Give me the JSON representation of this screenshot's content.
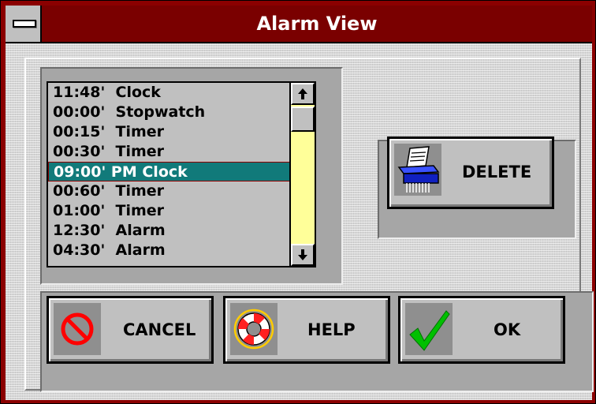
{
  "window": {
    "title": "Alarm View"
  },
  "alarms": [
    {
      "text": "11:48'  Clock"
    },
    {
      "text": "00:00'  Stopwatch"
    },
    {
      "text": "00:15'  Timer"
    },
    {
      "text": "00:30'  Timer"
    },
    {
      "text": "09:00' PM Clock",
      "selected": true
    },
    {
      "text": "00:60'  Timer"
    },
    {
      "text": "01:00'  Timer"
    },
    {
      "text": "12:30'  Alarm"
    },
    {
      "text": "04:30'  Alarm"
    }
  ],
  "scrollbar": {
    "up_icon": "arrow-up-icon",
    "down_icon": "arrow-down-icon"
  },
  "buttons": {
    "delete": {
      "label": "DELETE",
      "icon": "shredder-icon"
    },
    "cancel": {
      "label": "CANCEL",
      "icon": "prohibited-icon"
    },
    "help": {
      "label": "HELP",
      "icon": "life-preserver-icon"
    },
    "ok": {
      "label": "OK",
      "icon": "checkmark-icon"
    }
  },
  "colors": {
    "titlebar": "#7a0000",
    "selection": "#117a7a",
    "scroll_track": "#ffff99",
    "check": "#00c000"
  }
}
